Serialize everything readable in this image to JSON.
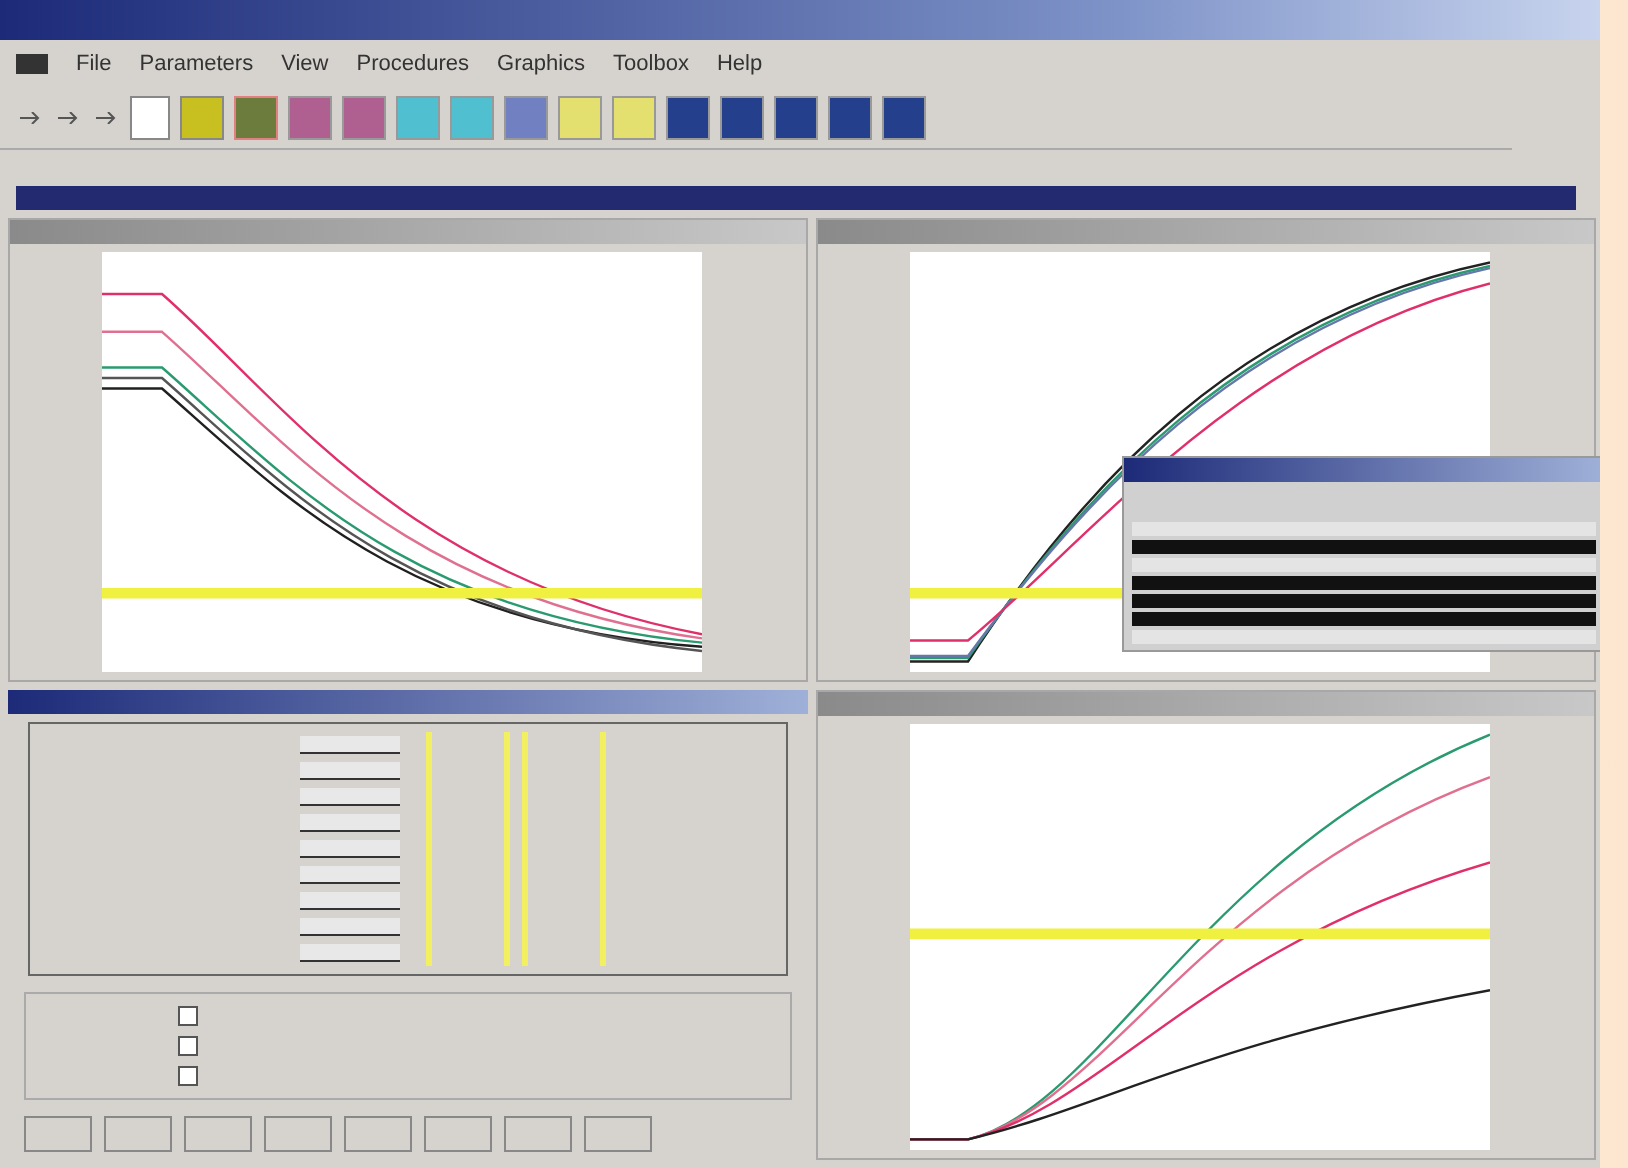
{
  "menu": [
    "File",
    "Parameters",
    "View",
    "Procedures",
    "Graphics",
    "Toolbox",
    "Help"
  ],
  "toolbar": [
    {
      "kind": "small"
    },
    {
      "kind": "small"
    },
    {
      "kind": "small"
    },
    {
      "kind": "new"
    },
    {
      "kind": "open"
    },
    {
      "kind": "save"
    },
    {
      "kind": "pink"
    },
    {
      "kind": "pink"
    },
    {
      "kind": "cyan"
    },
    {
      "kind": "cyan"
    },
    {
      "kind": "ring"
    },
    {
      "kind": "yellow"
    },
    {
      "kind": "yellow"
    },
    {
      "kind": "navy"
    },
    {
      "kind": "navy"
    },
    {
      "kind": "navy"
    },
    {
      "kind": "navy"
    },
    {
      "kind": "navy"
    }
  ],
  "progress": {
    "level": 1
  },
  "charts": [
    {
      "kind": "falling"
    },
    {
      "kind": "rising"
    },
    {
      "kind": "late"
    }
  ],
  "table": {
    "columns": [
      {
        "highlighted": false
      },
      {
        "highlighted": false
      },
      {
        "highlighted": false
      },
      {
        "highlighted": false
      },
      {
        "highlighted": true
      },
      {
        "highlighted": true
      },
      {
        "highlighted": false
      },
      {
        "highlighted": false
      }
    ],
    "rows": [
      {
        "kind": "entry"
      },
      {
        "kind": "entry"
      },
      {
        "kind": "entry"
      },
      {
        "kind": "entry"
      },
      {
        "kind": "entry"
      },
      {
        "kind": "entry"
      },
      {
        "kind": "entry"
      },
      {
        "kind": "entry"
      },
      {
        "kind": "entry"
      }
    ]
  },
  "options": [
    {
      "checked": false
    },
    {
      "checked": false
    },
    {
      "checked": false
    }
  ],
  "result_rows": [
    {
      "dark": false
    },
    {
      "dark": true
    },
    {
      "dark": false
    },
    {
      "dark": true
    },
    {
      "dark": true
    },
    {
      "dark": true
    },
    {
      "dark": false
    }
  ]
}
